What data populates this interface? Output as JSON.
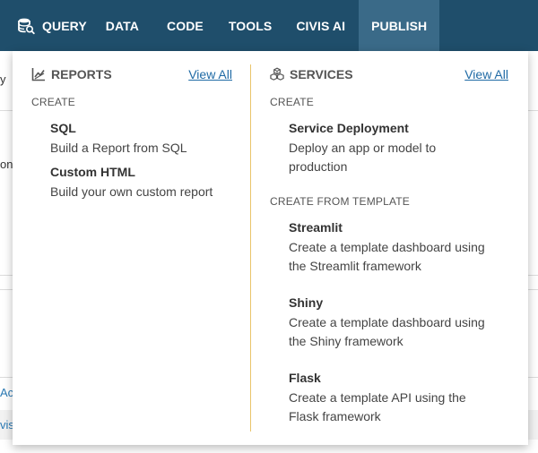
{
  "nav": {
    "query": "QUERY",
    "data": "DATA",
    "code": "CODE",
    "tools": "TOOLS",
    "civis_ai": "CIVIS AI",
    "publish": "PUBLISH"
  },
  "background": {
    "fragments": [
      "y",
      "on",
      "Acc",
      "vis"
    ]
  },
  "reports": {
    "title": "REPORTS",
    "view_all": "View All",
    "section": "CREATE",
    "items": [
      {
        "title": "SQL",
        "desc": "Build a Report from SQL"
      },
      {
        "title": "Custom HTML",
        "desc": "Build your own custom report"
      }
    ]
  },
  "services": {
    "title": "SERVICES",
    "view_all": "View All",
    "section_create": "CREATE",
    "section_template": "CREATE FROM TEMPLATE",
    "create_items": [
      {
        "title": "Service Deployment",
        "desc_line1": "Deploy an app or model to",
        "desc_line2": "production"
      }
    ],
    "template_items": [
      {
        "title": "Streamlit",
        "desc_line1": "Create a template dashboard using",
        "desc_line2": "the Streamlit framework"
      },
      {
        "title": "Shiny",
        "desc_line1": "Create a template dashboard using",
        "desc_line2": "the Shiny framework"
      },
      {
        "title": "Flask",
        "desc_line1": "Create a template API using the",
        "desc_line2": "Flask framework"
      }
    ]
  },
  "colors": {
    "navbar": "#1f4e6b",
    "navbar_active": "#3a6a88",
    "divider": "#e9c46a",
    "link": "#1f6aa5"
  }
}
